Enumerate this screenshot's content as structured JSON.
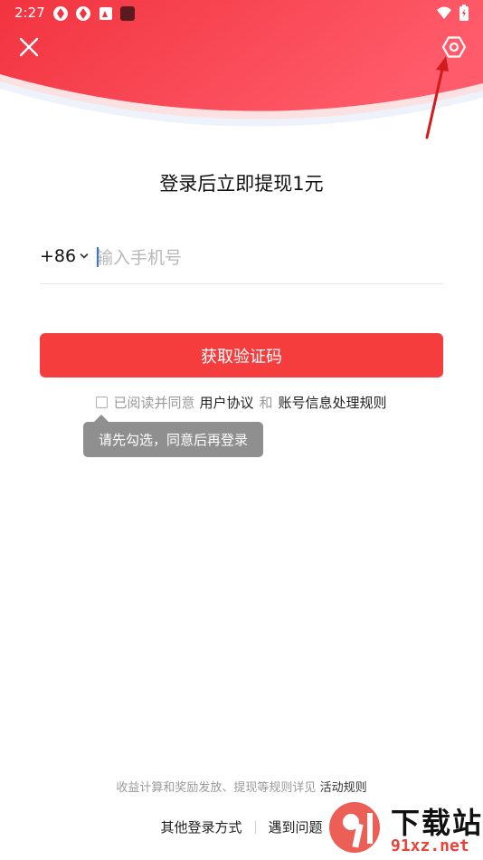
{
  "status_bar": {
    "time": "2:27",
    "left_icons": [
      "app-icon",
      "app-icon",
      "image-icon",
      "square-icon"
    ],
    "right_icons": [
      "wifi-icon",
      "battery-icon"
    ]
  },
  "header": {
    "close_icon": "close-icon",
    "settings_icon": "settings-hexagon-icon",
    "gradient_colors": [
      "#f5374a",
      "#ff5a6a"
    ]
  },
  "title": "登录后立即提现1元",
  "phone": {
    "country_code": "+86",
    "placeholder": "输入手机号",
    "value": ""
  },
  "get_code_button": "获取验证码",
  "agreement": {
    "prefix": "已阅读并同意",
    "user_agreement": "用户协议",
    "and": "和",
    "account_rules": "账号信息处理规则"
  },
  "tooltip": "请先勾选，同意后再登录",
  "rules_line": {
    "text": "收益计算和奖励发放、提现等规则详见",
    "link": "活动规则"
  },
  "bottom": {
    "other_login": "其他登录方式",
    "problem": "遇到问题"
  },
  "watermark": {
    "title": "下载站",
    "url": "91xz.net"
  },
  "colors": {
    "accent": "#f53d3d",
    "tooltip_bg": "#8f8f8f",
    "annotation_arrow": "#d01c1c"
  }
}
